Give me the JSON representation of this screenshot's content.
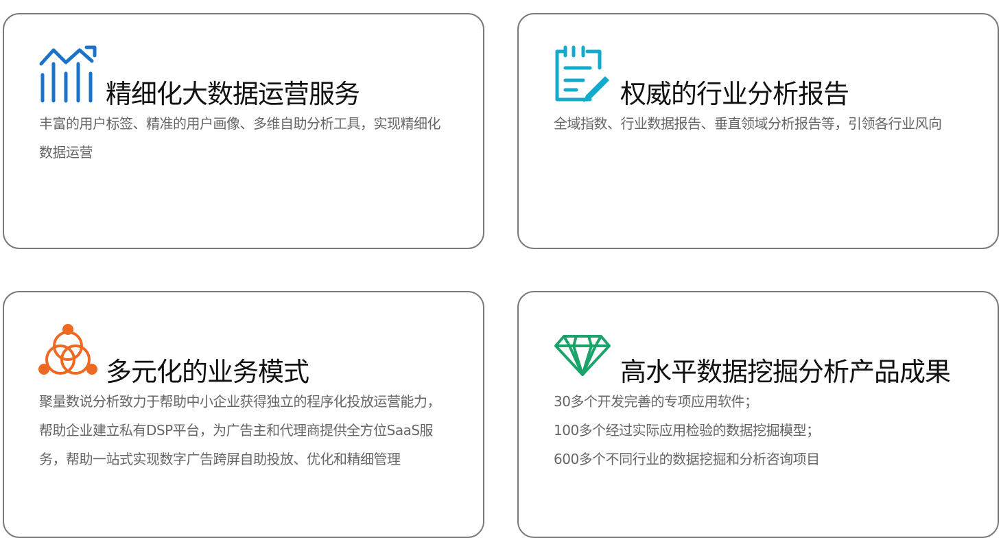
{
  "cards": [
    {
      "icon": "bar-chart-trend-icon",
      "color": "#1a73c8",
      "title": "精细化大数据运营服务",
      "lines": [
        "丰富的用户标签、精准的用户画像、多维自助分析工具，实现精细化数据运营"
      ]
    },
    {
      "icon": "clipboard-edit-icon",
      "color": "#14aacc",
      "title": "权威的行业分析报告",
      "lines": [
        "全域指数、行业数据报告、垂直领域分析报告等，引领各行业风向"
      ]
    },
    {
      "icon": "network-circles-icon",
      "color": "#ee6a22",
      "title": "多元化的业务模式",
      "lines": [
        "聚量数说分析致力于帮助中小企业获得独立的程序化投放运营能力，帮助企业建立私有DSP平台，为广告主和代理商提供全方位SaaS服务，帮助一站式实现数字广告跨屏自助投放、优化和精细管理"
      ]
    },
    {
      "icon": "diamond-icon",
      "color": "#1aa36a",
      "title": "高水平数据挖掘分析产品成果",
      "lines": [
        "30多个开发完善的专项应用软件；",
        "100多个经过实际应用检验的数据挖掘模型；",
        "600多个不同行业的数据挖掘和分析咨询项目"
      ]
    }
  ]
}
